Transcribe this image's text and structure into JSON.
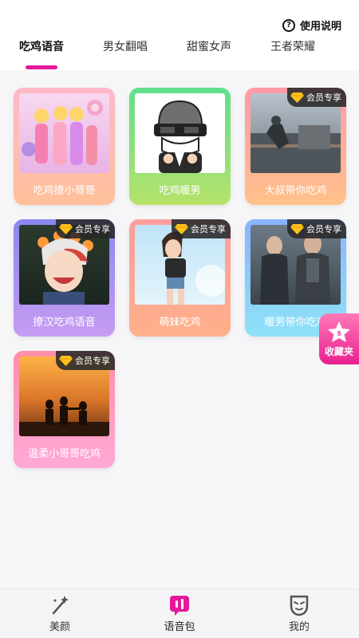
{
  "header": {
    "help_label": "使用说明",
    "help_icon": "question-icon"
  },
  "tabs": [
    {
      "label": "吃鸡语音",
      "active": true
    },
    {
      "label": "男女翻唱",
      "active": false
    },
    {
      "label": "甜蜜女声",
      "active": false
    },
    {
      "label": "王者荣耀",
      "active": false
    }
  ],
  "vip_label": "会员专享",
  "cards": [
    {
      "title": "吃鸡撩小哥哥",
      "vip": false
    },
    {
      "title": "吃鸡暖男",
      "vip": false
    },
    {
      "title": "大叔带你吃鸡",
      "vip": true
    },
    {
      "title": "撩汉吃鸡语音",
      "vip": true
    },
    {
      "title": "萌妹吃鸡",
      "vip": true
    },
    {
      "title": "暖男带你吃鸡",
      "vip": true
    },
    {
      "title": "温柔小哥哥吃鸡",
      "vip": true
    }
  ],
  "favorites": {
    "label": "收藏夹",
    "count": "9",
    "icon": "star-icon"
  },
  "bottom_nav": [
    {
      "label": "美颜",
      "icon": "magic-wand-icon"
    },
    {
      "label": "语音包",
      "icon": "voice-pack-icon",
      "active": true
    },
    {
      "label": "我的",
      "icon": "mask-icon"
    }
  ],
  "colors": {
    "accent": "#e4199b"
  }
}
